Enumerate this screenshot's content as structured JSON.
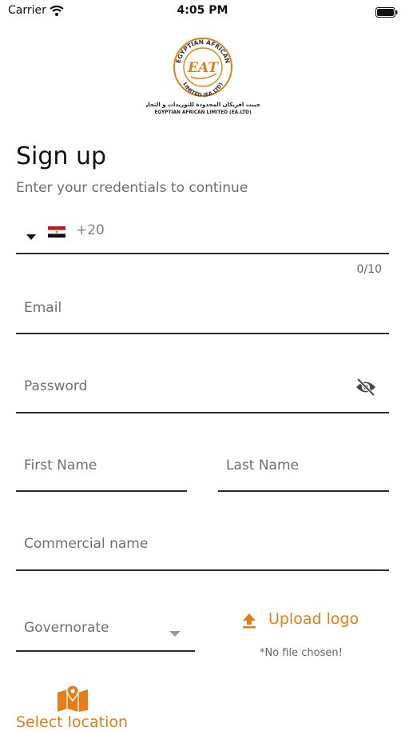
{
  "status_bar": {
    "carrier": "Carrier",
    "time": "4:05 PM"
  },
  "logo": {
    "top_text": "EGYPTIAN AFRICAN",
    "initials": "EAT",
    "bottom_text": "LIMITED (EA.LTD)",
    "arabic_text": "إيجيبت افريكان المحدودة للتوريدات و التجارة",
    "english_text": "EGYPTIAN AFRICAN LIMITED (EA.LTD)"
  },
  "header": {
    "title": "Sign up",
    "subtitle": "Enter your credentials to continue"
  },
  "phone": {
    "dial_code": "+20",
    "counter": "0/10"
  },
  "fields": {
    "email": "Email",
    "password": "Password",
    "first_name": "First Name",
    "last_name": "Last Name",
    "commercial_name": "Commercial name",
    "governorate": "Governorate"
  },
  "upload": {
    "label": "Upload logo",
    "status": "*No file chosen!"
  },
  "location": {
    "label": "Select location"
  },
  "icons": [
    "wifi-icon",
    "battery-icon",
    "caret-down-icon",
    "egypt-flag-icon",
    "eye-off-icon",
    "upload-icon",
    "map-icon"
  ],
  "colors": {
    "accent": "#e37e1a",
    "underline": "#2c2c2c",
    "label": "#707070"
  }
}
